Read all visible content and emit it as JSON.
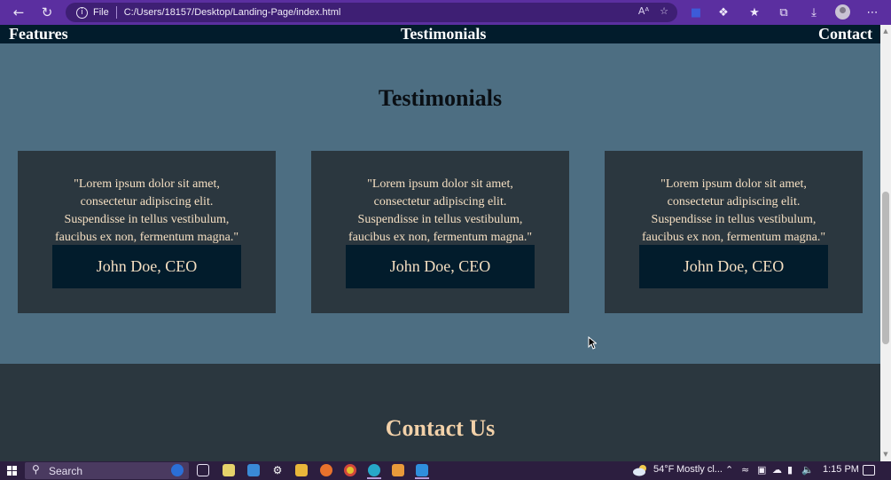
{
  "browser": {
    "address_prefix": "File",
    "url": "C:/Users/18157/Desktop/Landing-Page/index.html",
    "read_aloud_label": "Aᴬ"
  },
  "site_nav": {
    "items": [
      "Features",
      "Testimonials",
      "Contact"
    ]
  },
  "testimonials": {
    "title": "Testimonials",
    "cards": [
      {
        "quote": "\"Lorem ipsum dolor sit amet, consectetur adipiscing elit. Suspendisse in tellus vestibulum, faucibus ex non, fermentum magna.\"",
        "author": "John Doe, CEO"
      },
      {
        "quote": "\"Lorem ipsum dolor sit amet, consectetur adipiscing elit. Suspendisse in tellus vestibulum, faucibus ex non, fermentum magna.\"",
        "author": "John Doe, CEO"
      },
      {
        "quote": "\"Lorem ipsum dolor sit amet, consectetur adipiscing elit. Suspendisse in tellus vestibulum, faucibus ex non, fermentum magna.\"",
        "author": "John Doe, CEO"
      }
    ]
  },
  "contact": {
    "title": "Contact Us"
  },
  "taskbar": {
    "search_placeholder": "Search",
    "weather_temp": "54°F",
    "weather_desc": "Mostly cl...",
    "time": "1:15 PM"
  },
  "colors": {
    "browser_chrome": "#5b2fa0",
    "nav_background": "#021c2c",
    "section_background": "#4d6e82",
    "card_background": "#2b373f",
    "accent_text": "#f5dfc2"
  }
}
